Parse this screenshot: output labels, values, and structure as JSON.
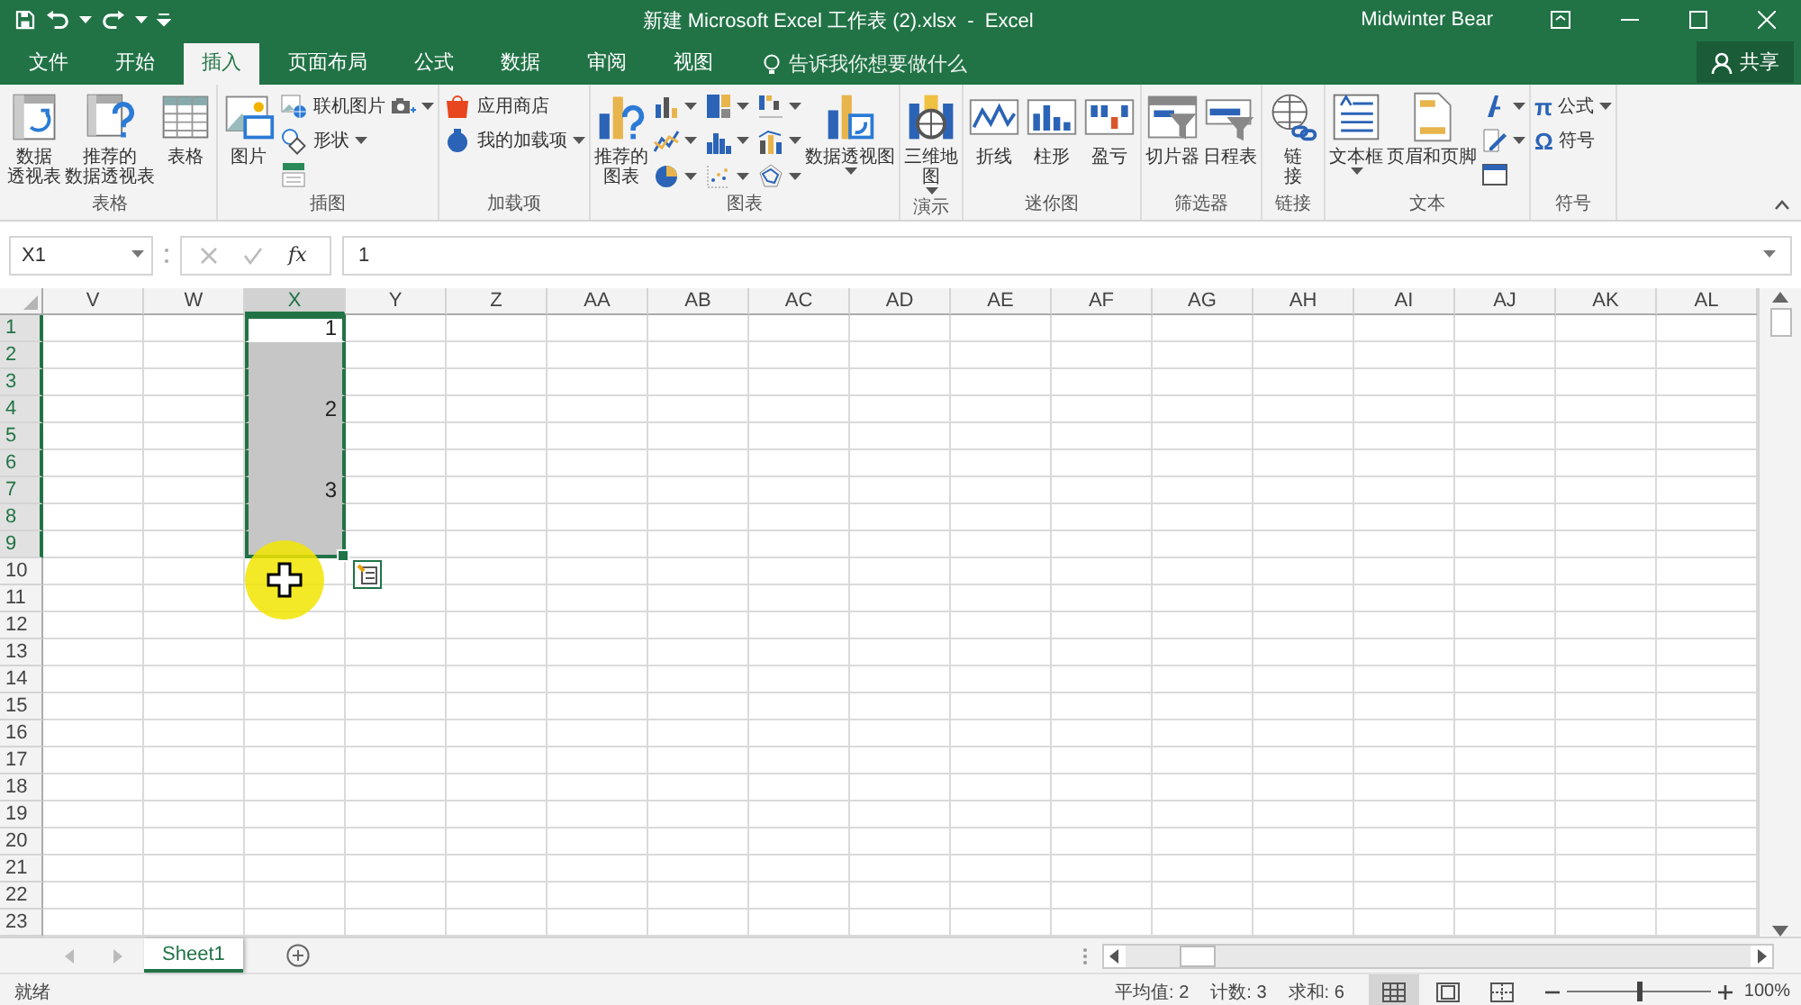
{
  "window": {
    "title": "新建 Microsoft Excel 工作表 (2).xlsx  -  Excel",
    "user": "Midwinter Bear"
  },
  "tabs": [
    {
      "label": "文件",
      "selected": false
    },
    {
      "label": "开始",
      "selected": false
    },
    {
      "label": "插入",
      "selected": true
    },
    {
      "label": "页面布局",
      "selected": false
    },
    {
      "label": "公式",
      "selected": false
    },
    {
      "label": "数据",
      "selected": false
    },
    {
      "label": "审阅",
      "selected": false
    },
    {
      "label": "视图",
      "selected": false
    }
  ],
  "tell_me": "告诉我你想要做什么",
  "share_button": "共享",
  "ribbon": {
    "groups": [
      {
        "label": "表格",
        "items": [
          {
            "kind": "large",
            "lines": [
              "数据",
              "透视表"
            ]
          },
          {
            "kind": "large",
            "lines": [
              "推荐的",
              "数据透视表"
            ]
          },
          {
            "kind": "large",
            "label": "表格"
          }
        ]
      },
      {
        "label": "插图",
        "items": [
          {
            "kind": "large",
            "label": "图片"
          },
          {
            "kind": "stack",
            "items": [
              {
                "kind": "small",
                "label": "联机图片"
              },
              {
                "kind": "small",
                "label": "形状",
                "dropdown": true
              },
              {
                "kind": "icon"
              }
            ]
          },
          {
            "kind": "stack",
            "items": [
              {
                "kind": "icon",
                "dropdown": true
              }
            ]
          }
        ]
      },
      {
        "label": "加载项",
        "items": [
          {
            "kind": "stack",
            "items": [
              {
                "kind": "small",
                "label": "应用商店"
              },
              {
                "kind": "small",
                "label": "我的加载项",
                "dropdown": true
              }
            ]
          }
        ]
      },
      {
        "label": "图表",
        "items": [
          {
            "kind": "large",
            "lines": [
              "推荐的",
              "图表"
            ]
          },
          {
            "kind": "grid",
            "items": [
              {
                "kind": "icon",
                "dropdown": true
              },
              {
                "kind": "icon",
                "dropdown": true
              },
              {
                "kind": "icon",
                "dropdown": true
              },
              {
                "kind": "icon",
                "dropdown": true
              },
              {
                "kind": "icon",
                "dropdown": true
              },
              {
                "kind": "icon",
                "dropdown": true
              },
              {
                "kind": "icon",
                "dropdown": true
              },
              {
                "kind": "icon",
                "dropdown": true
              },
              {
                "kind": "icon",
                "dropdown": true
              }
            ]
          },
          {
            "kind": "large",
            "label": "数据透视图",
            "dropdown": true
          }
        ]
      },
      {
        "label": "演示",
        "items": [
          {
            "kind": "large",
            "lines": [
              "三维地",
              "图"
            ],
            "dropdown": true
          }
        ]
      },
      {
        "label": "迷你图",
        "items": [
          {
            "kind": "large",
            "label": "折线"
          },
          {
            "kind": "large",
            "label": "柱形"
          },
          {
            "kind": "large",
            "label": "盈亏"
          }
        ]
      },
      {
        "label": "筛选器",
        "items": [
          {
            "kind": "large",
            "label": "切片器"
          },
          {
            "kind": "large",
            "label": "日程表"
          }
        ]
      },
      {
        "label": "链接",
        "items": [
          {
            "kind": "large",
            "lines": [
              "链",
              "接"
            ]
          }
        ]
      },
      {
        "label": "文本",
        "items": [
          {
            "kind": "large",
            "label": "文本框",
            "dropdown": true
          },
          {
            "kind": "large",
            "label": "页眉和页脚"
          },
          {
            "kind": "stack",
            "items": [
              {
                "kind": "icon",
                "dropdown": true
              },
              {
                "kind": "icon",
                "dropdown": true
              },
              {
                "kind": "icon"
              }
            ]
          }
        ]
      },
      {
        "label": "符号",
        "items": [
          {
            "kind": "stack",
            "items": [
              {
                "kind": "small",
                "glyph": "π",
                "label": "公式",
                "dropdown": true
              },
              {
                "kind": "small",
                "glyph": "Ω",
                "label": "符号"
              }
            ]
          }
        ]
      }
    ]
  },
  "formula_bar": {
    "name_box": "X1",
    "function_label": "fx",
    "value": "1"
  },
  "sheet": {
    "columns": [
      {
        "label": "V",
        "selected": false
      },
      {
        "label": "W",
        "selected": false
      },
      {
        "label": "X",
        "selected": true,
        "cells": [
          {
            "text": "1",
            "selected": true,
            "active": true
          },
          {
            "selected": true,
            "active": false
          },
          {
            "selected": true,
            "active": false
          },
          {
            "text": "2",
            "selected": true,
            "active": false
          },
          {
            "selected": true,
            "active": false
          },
          {
            "selected": true,
            "active": false
          },
          {
            "text": "3",
            "selected": true,
            "active": false
          },
          {
            "selected": true,
            "active": false
          },
          {
            "selected": true,
            "active": false
          }
        ]
      },
      {
        "label": "Y",
        "selected": false
      },
      {
        "label": "Z",
        "selected": false
      },
      {
        "label": "AA",
        "selected": false
      },
      {
        "label": "AB",
        "selected": false
      },
      {
        "label": "AC",
        "selected": false
      },
      {
        "label": "AD",
        "selected": false
      },
      {
        "label": "AE",
        "selected": false
      },
      {
        "label": "AF",
        "selected": false
      },
      {
        "label": "AG",
        "selected": false
      },
      {
        "label": "AH",
        "selected": false
      },
      {
        "label": "AI",
        "selected": false
      },
      {
        "label": "AJ",
        "selected": false
      },
      {
        "label": "AK",
        "selected": false
      },
      {
        "label": "AL",
        "selected": false
      }
    ],
    "rows": [
      {
        "label": "1",
        "selected": true
      },
      {
        "label": "2",
        "selected": true
      },
      {
        "label": "3",
        "selected": true
      },
      {
        "label": "4",
        "selected": true
      },
      {
        "label": "5",
        "selected": true
      },
      {
        "label": "6",
        "selected": true
      },
      {
        "label": "7",
        "selected": true
      },
      {
        "label": "8",
        "selected": true
      },
      {
        "label": "9",
        "selected": true
      },
      {
        "label": "10",
        "selected": false
      },
      {
        "label": "11",
        "selected": false
      },
      {
        "label": "12",
        "selected": false
      },
      {
        "label": "13",
        "selected": false
      },
      {
        "label": "14",
        "selected": false
      },
      {
        "label": "15",
        "selected": false
      },
      {
        "label": "16",
        "selected": false
      },
      {
        "label": "17",
        "selected": false
      },
      {
        "label": "18",
        "selected": false
      },
      {
        "label": "19",
        "selected": false
      },
      {
        "label": "20",
        "selected": false
      },
      {
        "label": "21",
        "selected": false
      },
      {
        "label": "22",
        "selected": false
      },
      {
        "label": "23",
        "selected": false
      }
    ]
  },
  "sheet_tabs": [
    {
      "label": "Sheet1",
      "selected": true
    }
  ],
  "status_bar": {
    "ready": "就绪",
    "average": "平均值: 2",
    "count": "计数: 3",
    "sum": "求和: 6",
    "views": [
      {
        "selected": true
      },
      {
        "selected": false
      },
      {
        "selected": false
      }
    ],
    "zoom": {
      "level": 0.5,
      "reading": "100%"
    }
  }
}
